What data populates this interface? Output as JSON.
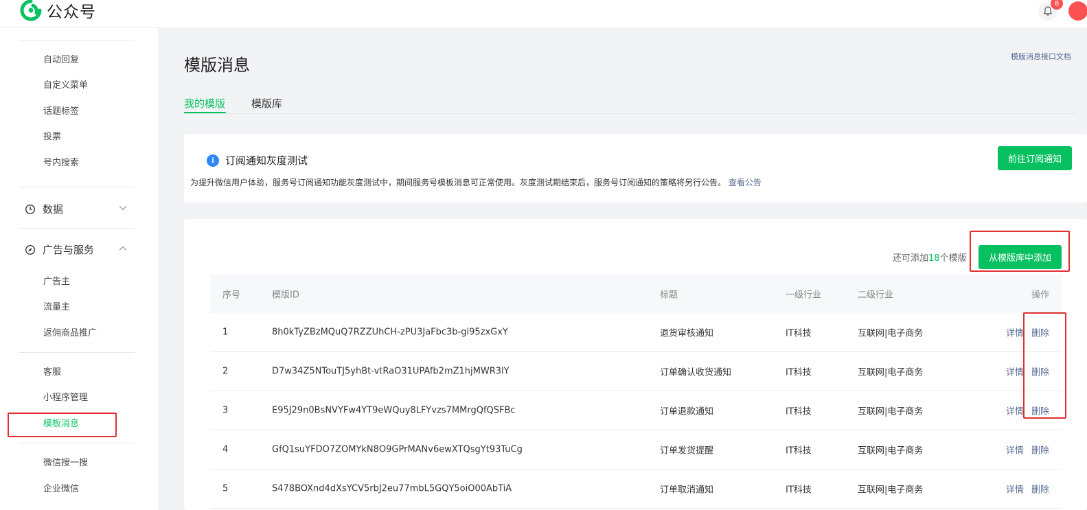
{
  "topbar": {
    "logo_text": "公众号",
    "notification_count": "8",
    "logo_color": "#07c160"
  },
  "sidebar": {
    "items_top": [
      {
        "label": "自动回复"
      },
      {
        "label": "自定义菜单"
      },
      {
        "label": "话题标签"
      },
      {
        "label": "投票"
      },
      {
        "label": "号内搜索"
      }
    ],
    "group_data": {
      "label": "数据",
      "icon": "clock-icon",
      "expanded": false
    },
    "group_ads": {
      "label": "广告与服务",
      "icon": "compass-icon",
      "expanded": true
    },
    "items_ads": [
      {
        "label": "广告主"
      },
      {
        "label": "流量主"
      },
      {
        "label": "返佣商品推广"
      }
    ],
    "items_more": [
      {
        "label": "客服"
      },
      {
        "label": "小程序管理"
      },
      {
        "label": "模板消息",
        "active": true
      },
      {
        "label": "微信搜一搜"
      },
      {
        "label": "企业微信"
      }
    ]
  },
  "main": {
    "title": "模版消息",
    "doc_link": "模版消息接口文档",
    "tabs": [
      {
        "label": "我的模版",
        "active": true
      },
      {
        "label": "模版库",
        "active": false
      }
    ],
    "notice": {
      "title": "订阅通知灰度测试",
      "description": "为提升微信用户体验，服务号订阅通知功能灰度测试中，期间服务号模板消息可正常使用。灰度测试期结束后，服务号订阅通知的策略将另行公告。",
      "link": "查看公告",
      "button": "前往订阅通知"
    },
    "quota_prefix": "还可添加",
    "quota_count": "18",
    "quota_suffix": "个模版",
    "add_button": "从模版库中添加",
    "table": {
      "columns": [
        "序号",
        "模版ID",
        "标题",
        "一级行业",
        "二级行业",
        "操作"
      ],
      "rows": [
        {
          "seq": "1",
          "id": "8h0kTyZBzMQuQ7RZZUhCH-zPU3JaFbc3b-gi95zxGxY",
          "title": "退货审核通知",
          "industry1": "IT科技",
          "industry2": "互联网|电子商务",
          "detail": "详情",
          "delete": "删除"
        },
        {
          "seq": "2",
          "id": "D7w34Z5NTouTJ5yhBt-vtRaO31UPAfb2mZ1hjMWR3lY",
          "title": "订单确认收货通知",
          "industry1": "IT科技",
          "industry2": "互联网|电子商务",
          "detail": "详情",
          "delete": "删除"
        },
        {
          "seq": "3",
          "id": "E95J29n0BsNVYFw4YT9eWQuy8LFYvzs7MMrgQfQSFBc",
          "title": "订单退款通知",
          "industry1": "IT科技",
          "industry2": "互联网|电子商务",
          "detail": "详情",
          "delete": "删除"
        },
        {
          "seq": "4",
          "id": "GfQ1suYFDO7ZOMYkN8O9GPrMANv6ewXTQsgYt93TuCg",
          "title": "订单发货提醒",
          "industry1": "IT科技",
          "industry2": "互联网|电子商务",
          "detail": "详情",
          "delete": "删除"
        },
        {
          "seq": "5",
          "id": "S478BOXnd4dXsYCV5rbJ2eu77mbL5GQY5oiO00AbTiA",
          "title": "订单取消通知",
          "industry1": "IT科技",
          "industry2": "互联网|电子商务",
          "detail": "详情",
          "delete": "删除"
        }
      ]
    }
  },
  "colors": {
    "accent": "#07c160",
    "link": "#576b95",
    "highlight": "#e02f2f",
    "info": "#2f86f6"
  }
}
